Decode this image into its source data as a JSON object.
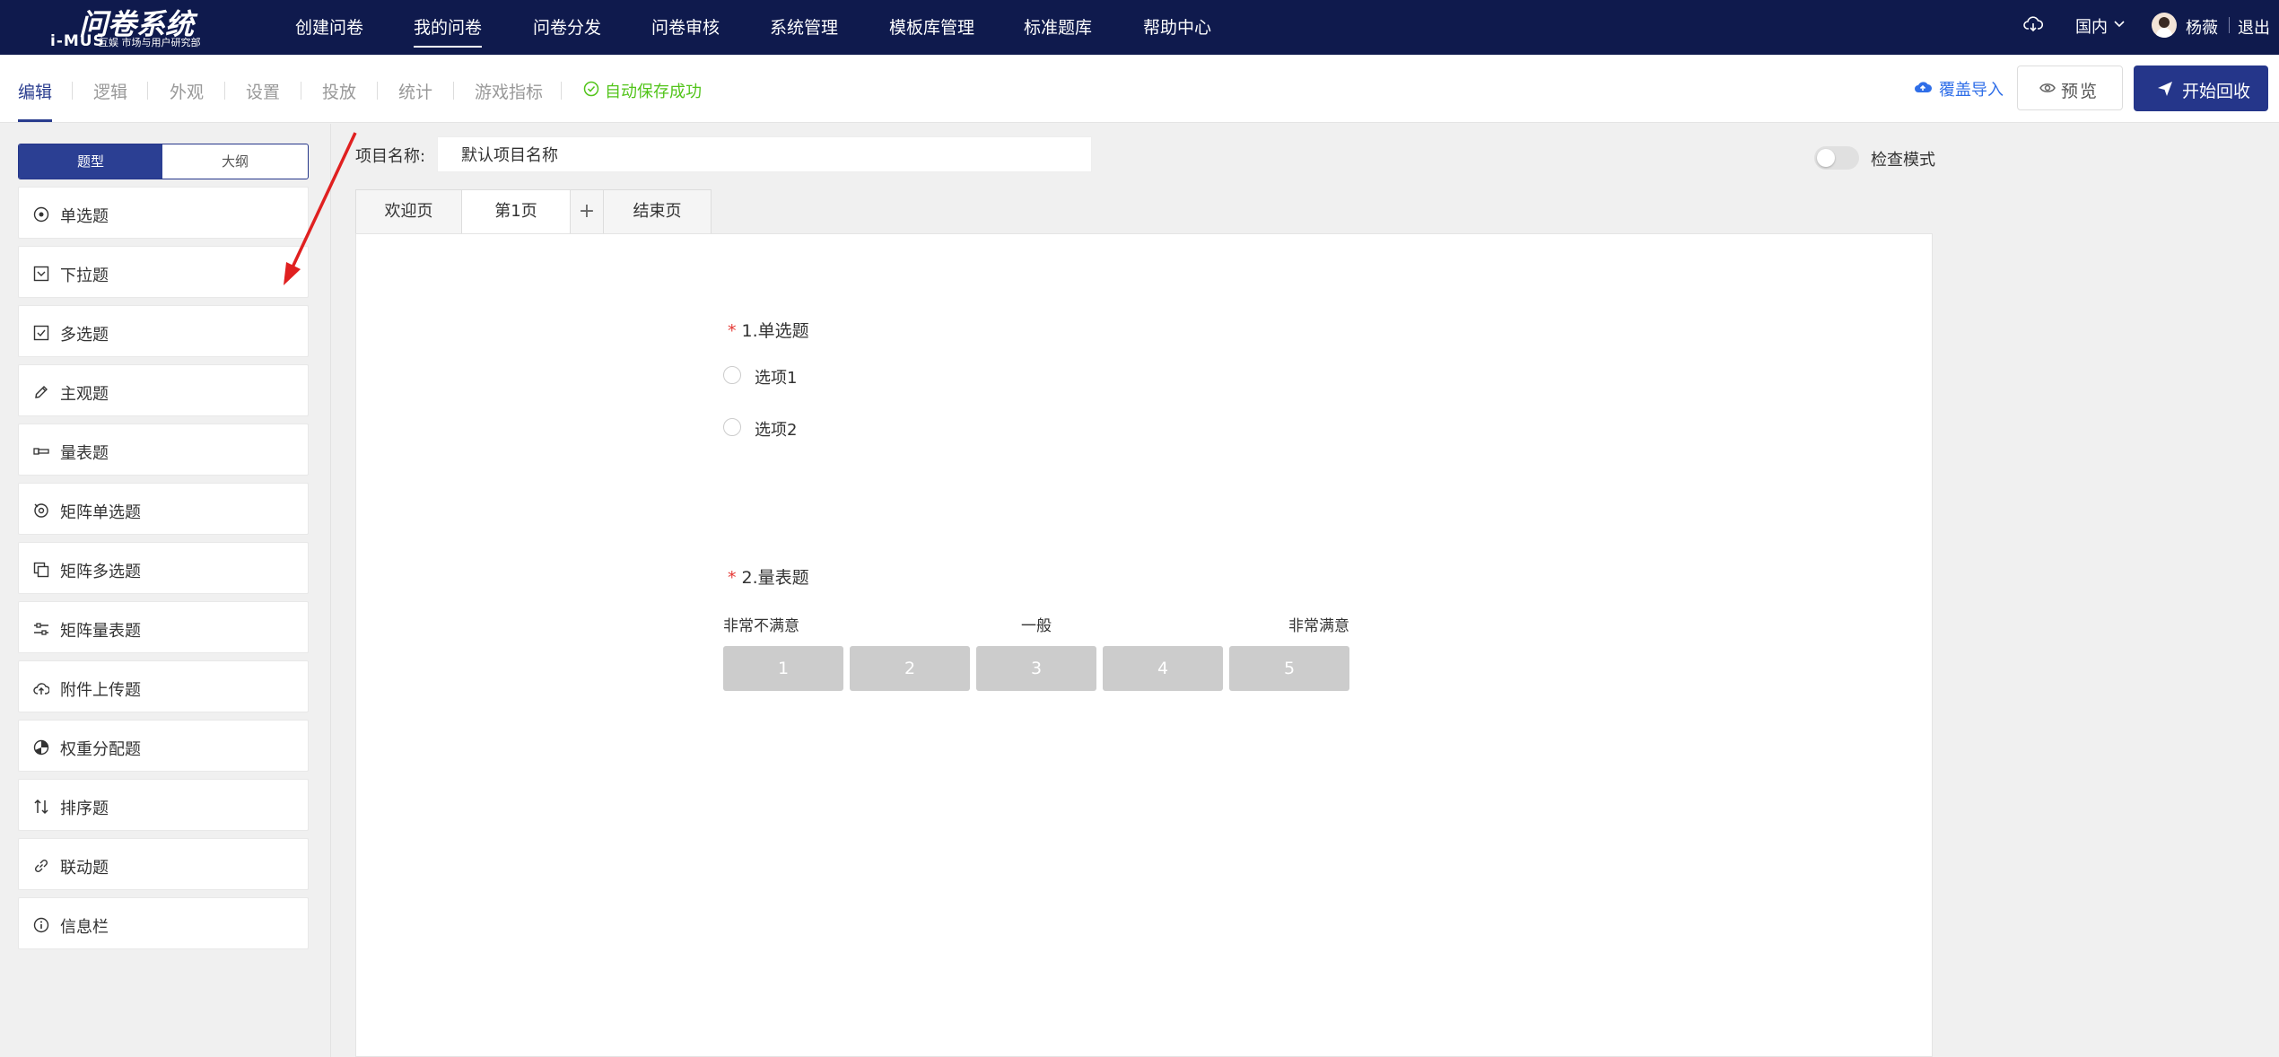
{
  "app": {
    "title": "问卷系统",
    "brand": "i-MUS",
    "subtitle": "互娱 市场与用户研究部"
  },
  "topnav": {
    "items": [
      "创建问卷",
      "我的问卷",
      "问卷分发",
      "问卷审核",
      "系统管理",
      "模板库管理",
      "标准题库",
      "帮助中心"
    ],
    "active_index": 1,
    "region": "国内",
    "user": "杨薇",
    "logout": "退出"
  },
  "toolbar": {
    "tabs": [
      "编辑",
      "逻辑",
      "外观",
      "设置",
      "投放",
      "统计",
      "游戏指标"
    ],
    "active_tab": 0,
    "autosave": "自动保存成功",
    "import_label": "覆盖导入",
    "preview_label": "预览",
    "start_label": "开始回收"
  },
  "sidebar": {
    "segment": [
      "题型",
      "大纲"
    ],
    "items": [
      {
        "label": "单选题",
        "icon": "radio-icon"
      },
      {
        "label": "下拉题",
        "icon": "dropdown-icon"
      },
      {
        "label": "多选题",
        "icon": "checkbox-icon"
      },
      {
        "label": "主观题",
        "icon": "pencil-icon"
      },
      {
        "label": "量表题",
        "icon": "scale-icon"
      },
      {
        "label": "矩阵单选题",
        "icon": "matrix-radio-icon"
      },
      {
        "label": "矩阵多选题",
        "icon": "matrix-checkbox-icon"
      },
      {
        "label": "矩阵量表题",
        "icon": "matrix-scale-icon"
      },
      {
        "label": "附件上传题",
        "icon": "upload-icon"
      },
      {
        "label": "权重分配题",
        "icon": "pie-icon"
      },
      {
        "label": "排序题",
        "icon": "sort-icon"
      },
      {
        "label": "联动题",
        "icon": "link-icon"
      },
      {
        "label": "信息栏",
        "icon": "info-icon"
      }
    ]
  },
  "project": {
    "label": "项目名称:",
    "name": "默认项目名称",
    "check_mode": "检查模式"
  },
  "pages": {
    "tabs": [
      "欢迎页",
      "第1页",
      "+",
      "结束页"
    ],
    "active_index": 1
  },
  "questions": {
    "q1": {
      "required_mark": "*",
      "title": "1.单选题",
      "options": [
        "选项1",
        "选项2"
      ]
    },
    "q2": {
      "required_mark": "*",
      "title": "2.量表题",
      "low_label": "非常不满意",
      "mid_label": "一般",
      "high_label": "非常满意",
      "scale": [
        "1",
        "2",
        "3",
        "4",
        "5"
      ]
    }
  },
  "colors": {
    "nav_bg": "#0f1a4d",
    "primary": "#25368a",
    "success": "#52c41a",
    "link": "#2f6ee8",
    "required": "#e53935",
    "annotation_arrow": "#e02020"
  }
}
